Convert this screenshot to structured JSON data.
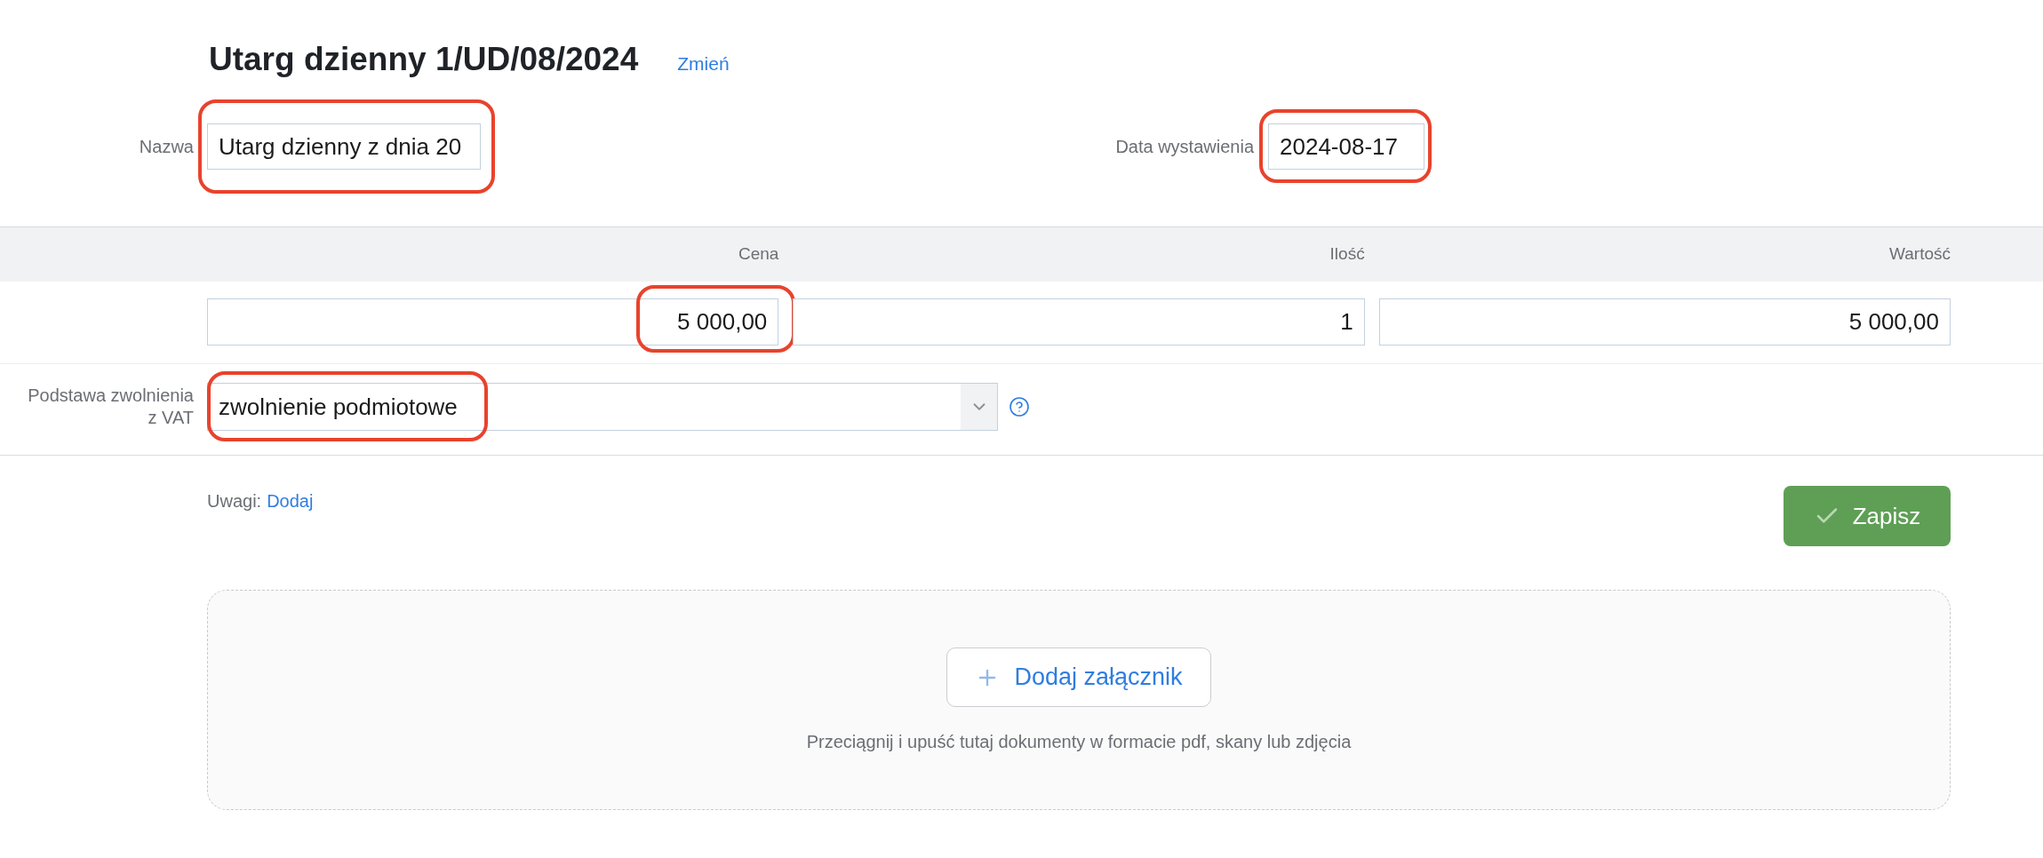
{
  "document": {
    "title": "Utarg dzienny 1/UD/08/2024",
    "change_link": "Zmień"
  },
  "fields": [
    {
      "label": "Nazwa",
      "value": "Utarg dzienny z dnia 20",
      "highlighted": true
    },
    {
      "label": "Data wystawienia",
      "value": "2024-08-17",
      "highlighted": true
    }
  ],
  "table": {
    "columns": [
      "Cena",
      "Ilość",
      "Wartość"
    ],
    "rows": [
      {
        "cells": [
          {
            "value": "5 000,00",
            "highlighted": true
          },
          {
            "value": "1",
            "highlighted": false
          },
          {
            "value": "5 000,00",
            "highlighted": false
          }
        ]
      }
    ]
  },
  "vat_exemption": {
    "label": "Podstawa zwolnienia z VAT",
    "value": "zwolnienie podmiotowe",
    "highlighted": true
  },
  "notes": {
    "label": "Uwagi:",
    "link": "Dodaj"
  },
  "save_button": {
    "label": "Zapisz"
  },
  "attachments": {
    "button": "Dodaj załącznik",
    "hint": "Przeciągnij i upuść tutaj dokumenty w formacie pdf, skany lub zdjęcia"
  }
}
